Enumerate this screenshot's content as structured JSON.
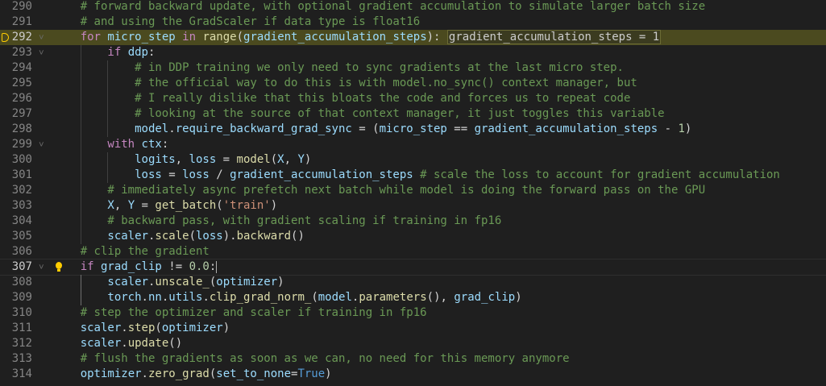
{
  "editor": {
    "language": "python",
    "colors": {
      "background": "#1f1f1f",
      "keyword": "#c586c0",
      "comment": "#6a9955",
      "function": "#dcdcaa",
      "variable": "#9cdcfe",
      "string": "#ce9178",
      "number": "#b5cea8",
      "debug_highlight": "#4b4a1f"
    },
    "lines": [
      {
        "n": "290",
        "indent": 1,
        "tokens": [
          [
            "cm",
            "# forward backward update, with optional gradient accumulation to simulate larger batch size"
          ]
        ]
      },
      {
        "n": "291",
        "indent": 1,
        "tokens": [
          [
            "cm",
            "# and using the GradScaler if data type is float16"
          ]
        ]
      },
      {
        "n": "292",
        "indent": 1,
        "debug": true,
        "fold": true,
        "tokens": [
          [
            "kw",
            "for"
          ],
          [
            "plain",
            " "
          ],
          [
            "var",
            "micro_step"
          ],
          [
            "plain",
            " "
          ],
          [
            "kw",
            "in"
          ],
          [
            "plain",
            " "
          ],
          [
            "fn",
            "range"
          ],
          [
            "plain",
            "("
          ],
          [
            "var",
            "gradient_accumulation_steps"
          ],
          [
            "plain",
            "): "
          ],
          [
            "inlay",
            "gradient_accumulation_steps = 1"
          ]
        ]
      },
      {
        "n": "293",
        "indent": 2,
        "fold": true,
        "tokens": [
          [
            "kw",
            "if"
          ],
          [
            "plain",
            " "
          ],
          [
            "var",
            "ddp"
          ],
          [
            "plain",
            ":"
          ]
        ]
      },
      {
        "n": "294",
        "indent": 3,
        "tokens": [
          [
            "cm",
            "# in DDP training we only need to sync gradients at the last micro step."
          ]
        ]
      },
      {
        "n": "295",
        "indent": 3,
        "tokens": [
          [
            "cm",
            "# the official way to do this is with model.no_sync() context manager, but"
          ]
        ]
      },
      {
        "n": "296",
        "indent": 3,
        "tokens": [
          [
            "cm",
            "# I really dislike that this bloats the code and forces us to repeat code"
          ]
        ]
      },
      {
        "n": "297",
        "indent": 3,
        "tokens": [
          [
            "cm",
            "# looking at the source of that context manager, it just toggles this variable"
          ]
        ]
      },
      {
        "n": "298",
        "indent": 3,
        "tokens": [
          [
            "var",
            "model"
          ],
          [
            "plain",
            "."
          ],
          [
            "var",
            "require_backward_grad_sync"
          ],
          [
            "plain",
            " = ("
          ],
          [
            "var",
            "micro_step"
          ],
          [
            "plain",
            " == "
          ],
          [
            "var",
            "gradient_accumulation_steps"
          ],
          [
            "plain",
            " - "
          ],
          [
            "num",
            "1"
          ],
          [
            "plain",
            ")"
          ]
        ]
      },
      {
        "n": "299",
        "indent": 2,
        "fold": true,
        "tokens": [
          [
            "kw",
            "with"
          ],
          [
            "plain",
            " "
          ],
          [
            "var",
            "ctx"
          ],
          [
            "plain",
            ":"
          ]
        ]
      },
      {
        "n": "300",
        "indent": 3,
        "tokens": [
          [
            "var",
            "logits"
          ],
          [
            "plain",
            ", "
          ],
          [
            "var",
            "loss"
          ],
          [
            "plain",
            " = "
          ],
          [
            "fn",
            "model"
          ],
          [
            "plain",
            "("
          ],
          [
            "var",
            "X"
          ],
          [
            "plain",
            ", "
          ],
          [
            "var",
            "Y"
          ],
          [
            "plain",
            ")"
          ]
        ]
      },
      {
        "n": "301",
        "indent": 3,
        "tokens": [
          [
            "var",
            "loss"
          ],
          [
            "plain",
            " = "
          ],
          [
            "var",
            "loss"
          ],
          [
            "plain",
            " / "
          ],
          [
            "var",
            "gradient_accumulation_steps"
          ],
          [
            "plain",
            " "
          ],
          [
            "cm",
            "# scale the loss to account for gradient accumulation"
          ]
        ]
      },
      {
        "n": "302",
        "indent": 2,
        "tokens": [
          [
            "cm",
            "# immediately async prefetch next batch while model is doing the forward pass on the GPU"
          ]
        ]
      },
      {
        "n": "303",
        "indent": 2,
        "tokens": [
          [
            "var",
            "X"
          ],
          [
            "plain",
            ", "
          ],
          [
            "var",
            "Y"
          ],
          [
            "plain",
            " = "
          ],
          [
            "fn",
            "get_batch"
          ],
          [
            "plain",
            "("
          ],
          [
            "str",
            "'train'"
          ],
          [
            "plain",
            ")"
          ]
        ]
      },
      {
        "n": "304",
        "indent": 2,
        "tokens": [
          [
            "cm",
            "# backward pass, with gradient scaling if training in fp16"
          ]
        ]
      },
      {
        "n": "305",
        "indent": 2,
        "tokens": [
          [
            "var",
            "scaler"
          ],
          [
            "plain",
            "."
          ],
          [
            "fn",
            "scale"
          ],
          [
            "plain",
            "("
          ],
          [
            "var",
            "loss"
          ],
          [
            "plain",
            ")."
          ],
          [
            "fn",
            "backward"
          ],
          [
            "plain",
            "()"
          ]
        ]
      },
      {
        "n": "306",
        "indent": 1,
        "tokens": [
          [
            "cm",
            "# clip the gradient"
          ]
        ]
      },
      {
        "n": "307",
        "indent": 1,
        "active": true,
        "bulb": true,
        "fold": true,
        "tokens": [
          [
            "kw",
            "if"
          ],
          [
            "plain",
            " "
          ],
          [
            "var",
            "grad_clip"
          ],
          [
            "plain",
            " != "
          ],
          [
            "num",
            "0.0"
          ],
          [
            "plain",
            ":"
          ],
          [
            "cursor",
            ""
          ]
        ]
      },
      {
        "n": "308",
        "indent": 2,
        "tokens": [
          [
            "var",
            "scaler"
          ],
          [
            "plain",
            "."
          ],
          [
            "fn",
            "unscale_"
          ],
          [
            "plain",
            "("
          ],
          [
            "var",
            "optimizer"
          ],
          [
            "plain",
            ")"
          ]
        ]
      },
      {
        "n": "309",
        "indent": 2,
        "tokens": [
          [
            "var",
            "torch"
          ],
          [
            "plain",
            "."
          ],
          [
            "var",
            "nn"
          ],
          [
            "plain",
            "."
          ],
          [
            "var",
            "utils"
          ],
          [
            "plain",
            "."
          ],
          [
            "fn",
            "clip_grad_norm_"
          ],
          [
            "plain",
            "("
          ],
          [
            "var",
            "model"
          ],
          [
            "plain",
            "."
          ],
          [
            "fn",
            "parameters"
          ],
          [
            "plain",
            "(), "
          ],
          [
            "var",
            "grad_clip"
          ],
          [
            "plain",
            ")"
          ]
        ]
      },
      {
        "n": "310",
        "indent": 1,
        "tokens": [
          [
            "cm",
            "# step the optimizer and scaler if training in fp16"
          ]
        ]
      },
      {
        "n": "311",
        "indent": 1,
        "tokens": [
          [
            "var",
            "scaler"
          ],
          [
            "plain",
            "."
          ],
          [
            "fn",
            "step"
          ],
          [
            "plain",
            "("
          ],
          [
            "var",
            "optimizer"
          ],
          [
            "plain",
            ")"
          ]
        ]
      },
      {
        "n": "312",
        "indent": 1,
        "tokens": [
          [
            "var",
            "scaler"
          ],
          [
            "plain",
            "."
          ],
          [
            "fn",
            "update"
          ],
          [
            "plain",
            "()"
          ]
        ]
      },
      {
        "n": "313",
        "indent": 1,
        "tokens": [
          [
            "cm",
            "# flush the gradients as soon as we can, no need for this memory anymore"
          ]
        ]
      },
      {
        "n": "314",
        "indent": 1,
        "tokens": [
          [
            "var",
            "optimizer"
          ],
          [
            "plain",
            "."
          ],
          [
            "fn",
            "zero_grad"
          ],
          [
            "plain",
            "("
          ],
          [
            "var",
            "set_to_none"
          ],
          [
            "plain",
            "="
          ],
          [
            "const",
            "True"
          ],
          [
            "plain",
            ")"
          ]
        ]
      }
    ]
  }
}
